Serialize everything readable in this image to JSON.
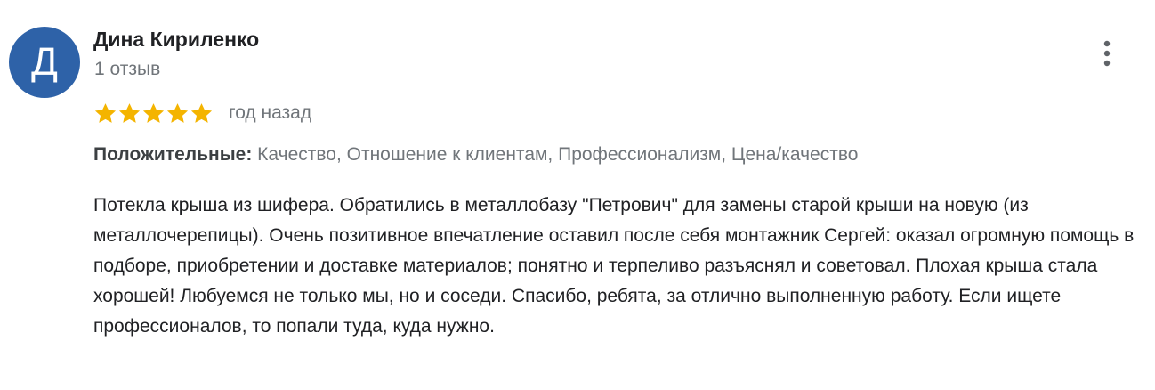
{
  "review": {
    "author": {
      "initial": "Д",
      "name": "Дина Кириленко",
      "reviews_count": "1 отзыв",
      "avatar_color": "#2e62a8"
    },
    "rating": {
      "stars": 5,
      "max_stars": 5,
      "star_color": "#f4b400"
    },
    "time_ago": "год назад",
    "highlights": {
      "label": "Положительные:",
      "values": "Качество, Отношение к клиентам, Профессионализм, Цена/качество"
    },
    "text": "Потекла крыша из шифера. Обратились в металлобазу \"Петрович\" для замены старой крыши на новую (из металлочерепицы). Очень позитивное впечатление оставил после себя монтажник Сергей: оказал огромную помощь в подборе, приобретении и доставке материалов; понятно и терпеливо разъяснял и советовал. Плохая крыша стала хорошей! Любуемся не только мы, но и соседи. Спасибо, ребята, за отлично выполненную работу. Если ищете профессионалов, то попали туда, куда нужно.",
    "menu_icon": "more-vertical-icon"
  }
}
